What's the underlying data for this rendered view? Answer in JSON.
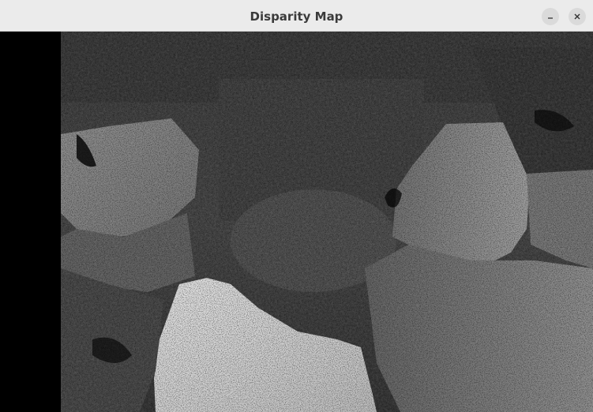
{
  "window": {
    "title": "Disparity Map",
    "minimize_label": "–",
    "close_label": "✕"
  },
  "image": {
    "content": "grayscale-disparity-map",
    "icon_minimize": "minimize-icon",
    "icon_close": "close-icon"
  }
}
